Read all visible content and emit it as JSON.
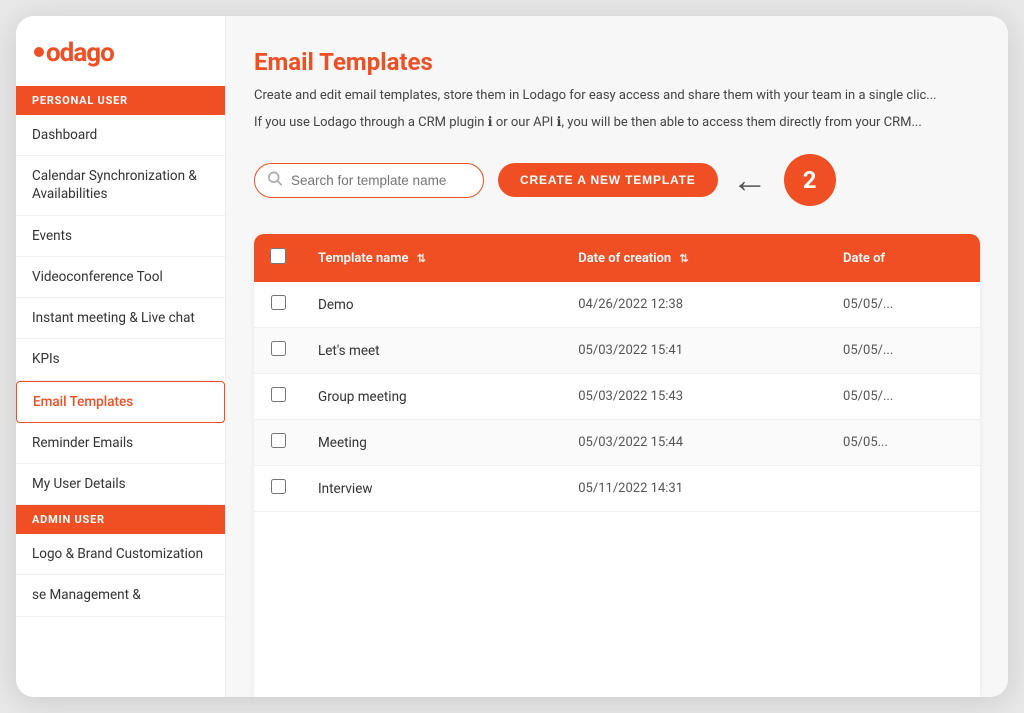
{
  "logo": {
    "text": "lodago"
  },
  "sidebar": {
    "personal_user_label": "PERSONAL USER",
    "admin_user_label": "ADMIN USER",
    "items_personal": [
      {
        "label": "Dashboard",
        "active": false,
        "name": "dashboard"
      },
      {
        "label": "Calendar Synchronization & Availabilities",
        "active": false,
        "name": "calendar-sync"
      },
      {
        "label": "Events",
        "active": false,
        "name": "events"
      },
      {
        "label": "Videoconference Tool",
        "active": false,
        "name": "videoconference"
      },
      {
        "label": "Instant meeting & Live chat",
        "active": false,
        "name": "instant-meeting"
      },
      {
        "label": "KPIs",
        "active": false,
        "name": "kpis"
      },
      {
        "label": "Email Templates",
        "active": true,
        "name": "email-templates"
      },
      {
        "label": "Reminder Emails",
        "active": false,
        "name": "reminder-emails"
      },
      {
        "label": "My User Details",
        "active": false,
        "name": "user-details"
      }
    ],
    "items_admin": [
      {
        "label": "Logo & Brand Customization",
        "active": false,
        "name": "logo-brand"
      },
      {
        "label": "se Management &",
        "active": false,
        "name": "se-management"
      }
    ]
  },
  "page": {
    "title": "Email Templates",
    "description": "Create and edit email templates, store them in Lodago for easy access and share them with your team in a single clic...",
    "description2": "If you use Lodago through a CRM plugin ℹ or our API ℹ, you will be then able to access them directly from your CRM...",
    "search_placeholder": "Search for template name",
    "create_button_label": "CREATE A NEW TEMPLATE",
    "step_number": "2"
  },
  "table": {
    "columns": [
      {
        "label": "",
        "key": "checkbox"
      },
      {
        "label": "Template name",
        "key": "name",
        "sortable": true
      },
      {
        "label": "Date of creation",
        "key": "date_created",
        "sortable": true
      },
      {
        "label": "Date of",
        "key": "date_other",
        "sortable": false
      }
    ],
    "rows": [
      {
        "name": "Demo",
        "date_created": "04/26/2022 12:38",
        "date_other": "05/05/..."
      },
      {
        "name": "Let's meet",
        "date_created": "05/03/2022 15:41",
        "date_other": "05/05/..."
      },
      {
        "name": "Group meeting",
        "date_created": "05/03/2022 15:43",
        "date_other": "05/05/..."
      },
      {
        "name": "Meeting",
        "date_created": "05/03/2022 15:44",
        "date_other": "05/05..."
      },
      {
        "name": "Interview",
        "date_created": "05/11/2022 14:31",
        "date_other": ""
      }
    ]
  },
  "colors": {
    "brand": "#f04e23",
    "sidebar_bg": "#ffffff",
    "main_bg": "#f7f7f7"
  }
}
